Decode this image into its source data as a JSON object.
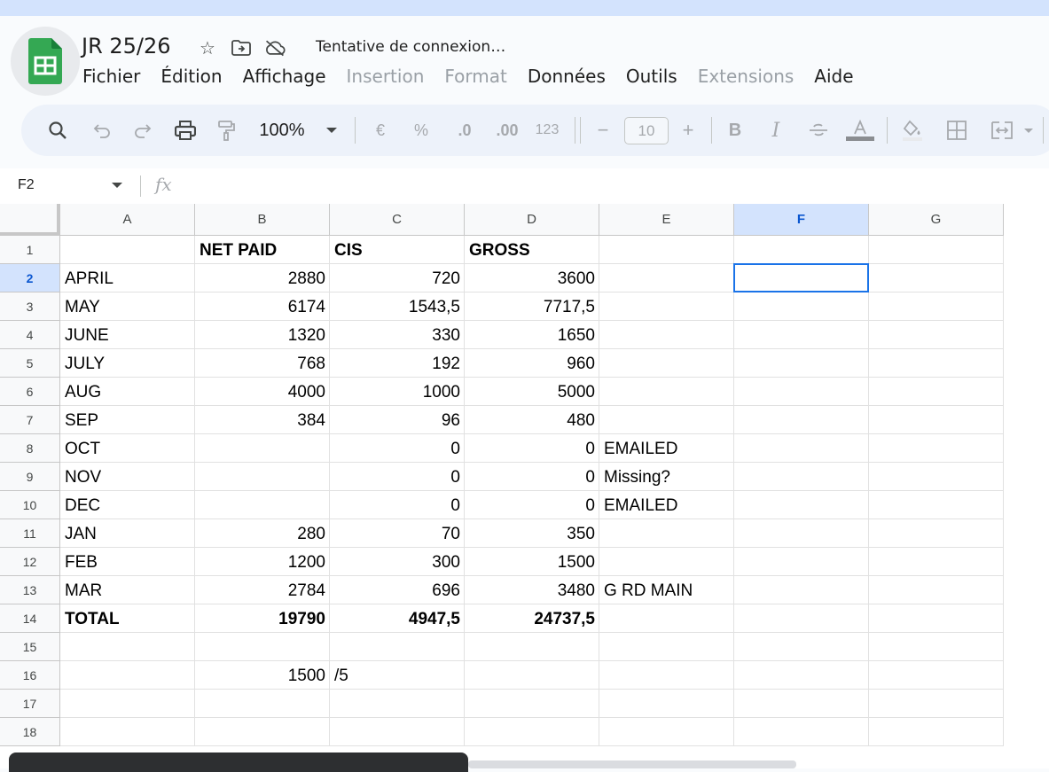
{
  "document": {
    "title": "JR 25/26",
    "status": "Tentative de connexion…"
  },
  "icons": {
    "star": "star-icon",
    "move": "move-to-folder-icon",
    "cloud": "cloud-offline-icon"
  },
  "menu": [
    {
      "label": "Fichier",
      "enabled": true
    },
    {
      "label": "Édition",
      "enabled": true
    },
    {
      "label": "Affichage",
      "enabled": true
    },
    {
      "label": "Insertion",
      "enabled": false
    },
    {
      "label": "Format",
      "enabled": false
    },
    {
      "label": "Données",
      "enabled": true
    },
    {
      "label": "Outils",
      "enabled": true
    },
    {
      "label": "Extensions",
      "enabled": false
    },
    {
      "label": "Aide",
      "enabled": true
    }
  ],
  "toolbar": {
    "zoom": "100%",
    "currency": "€",
    "percent": "%",
    "dec_decrease": ".0",
    "dec_increase": ".00",
    "number_format": "123",
    "minus": "−",
    "font_size": "10",
    "plus": "+",
    "bold": "B",
    "italic": "I"
  },
  "formula_bar": {
    "cell_ref": "F2",
    "fx": "fx",
    "content": ""
  },
  "sheet": {
    "columns": [
      "A",
      "B",
      "C",
      "D",
      "E",
      "F",
      "G"
    ],
    "selected_column": "F",
    "selected_row": "2",
    "rows": [
      {
        "num": "1",
        "cells": [
          "",
          "NET PAID",
          "CIS",
          "GROSS",
          "",
          "",
          ""
        ]
      },
      {
        "num": "2",
        "cells": [
          "APRIL",
          "2880",
          "720",
          "3600",
          "",
          "",
          ""
        ]
      },
      {
        "num": "3",
        "cells": [
          "MAY",
          "6174",
          "1543,5",
          "7717,5",
          "",
          "",
          ""
        ]
      },
      {
        "num": "4",
        "cells": [
          "JUNE",
          "1320",
          "330",
          "1650",
          "",
          "",
          ""
        ]
      },
      {
        "num": "5",
        "cells": [
          "JULY",
          "768",
          "192",
          "960",
          "",
          "",
          ""
        ]
      },
      {
        "num": "6",
        "cells": [
          "AUG",
          "4000",
          "1000",
          "5000",
          "",
          "",
          ""
        ]
      },
      {
        "num": "7",
        "cells": [
          "SEP",
          "384",
          "96",
          "480",
          "",
          "",
          ""
        ]
      },
      {
        "num": "8",
        "cells": [
          "OCT",
          "",
          "0",
          "0",
          "EMAILED",
          "",
          ""
        ]
      },
      {
        "num": "9",
        "cells": [
          "NOV",
          "",
          "0",
          "0",
          "Missing?",
          "",
          ""
        ]
      },
      {
        "num": "10",
        "cells": [
          "DEC",
          "",
          "0",
          "0",
          "EMAILED",
          "",
          ""
        ]
      },
      {
        "num": "11",
        "cells": [
          "JAN",
          "280",
          "70",
          "350",
          "",
          "",
          ""
        ]
      },
      {
        "num": "12",
        "cells": [
          "FEB",
          "1200",
          "300",
          "1500",
          "",
          "",
          ""
        ]
      },
      {
        "num": "13",
        "cells": [
          "MAR",
          "2784",
          "696",
          "3480",
          "G RD MAIN",
          "",
          ""
        ]
      },
      {
        "num": "14",
        "cells": [
          "TOTAL",
          "19790",
          "4947,5",
          "24737,5",
          "",
          "",
          ""
        ]
      },
      {
        "num": "15",
        "cells": [
          "",
          "",
          "",
          "",
          "",
          "",
          ""
        ]
      },
      {
        "num": "16",
        "cells": [
          "",
          "1500",
          "/5",
          "",
          "",
          "",
          ""
        ]
      },
      {
        "num": "17",
        "cells": [
          "",
          "",
          "",
          "",
          "",
          "",
          ""
        ]
      },
      {
        "num": "18",
        "cells": [
          "",
          "",
          "",
          "",
          "",
          "",
          ""
        ]
      }
    ],
    "bold_rows": [
      "1",
      "14"
    ],
    "right_aligned_columns": [
      1,
      2,
      3
    ]
  }
}
